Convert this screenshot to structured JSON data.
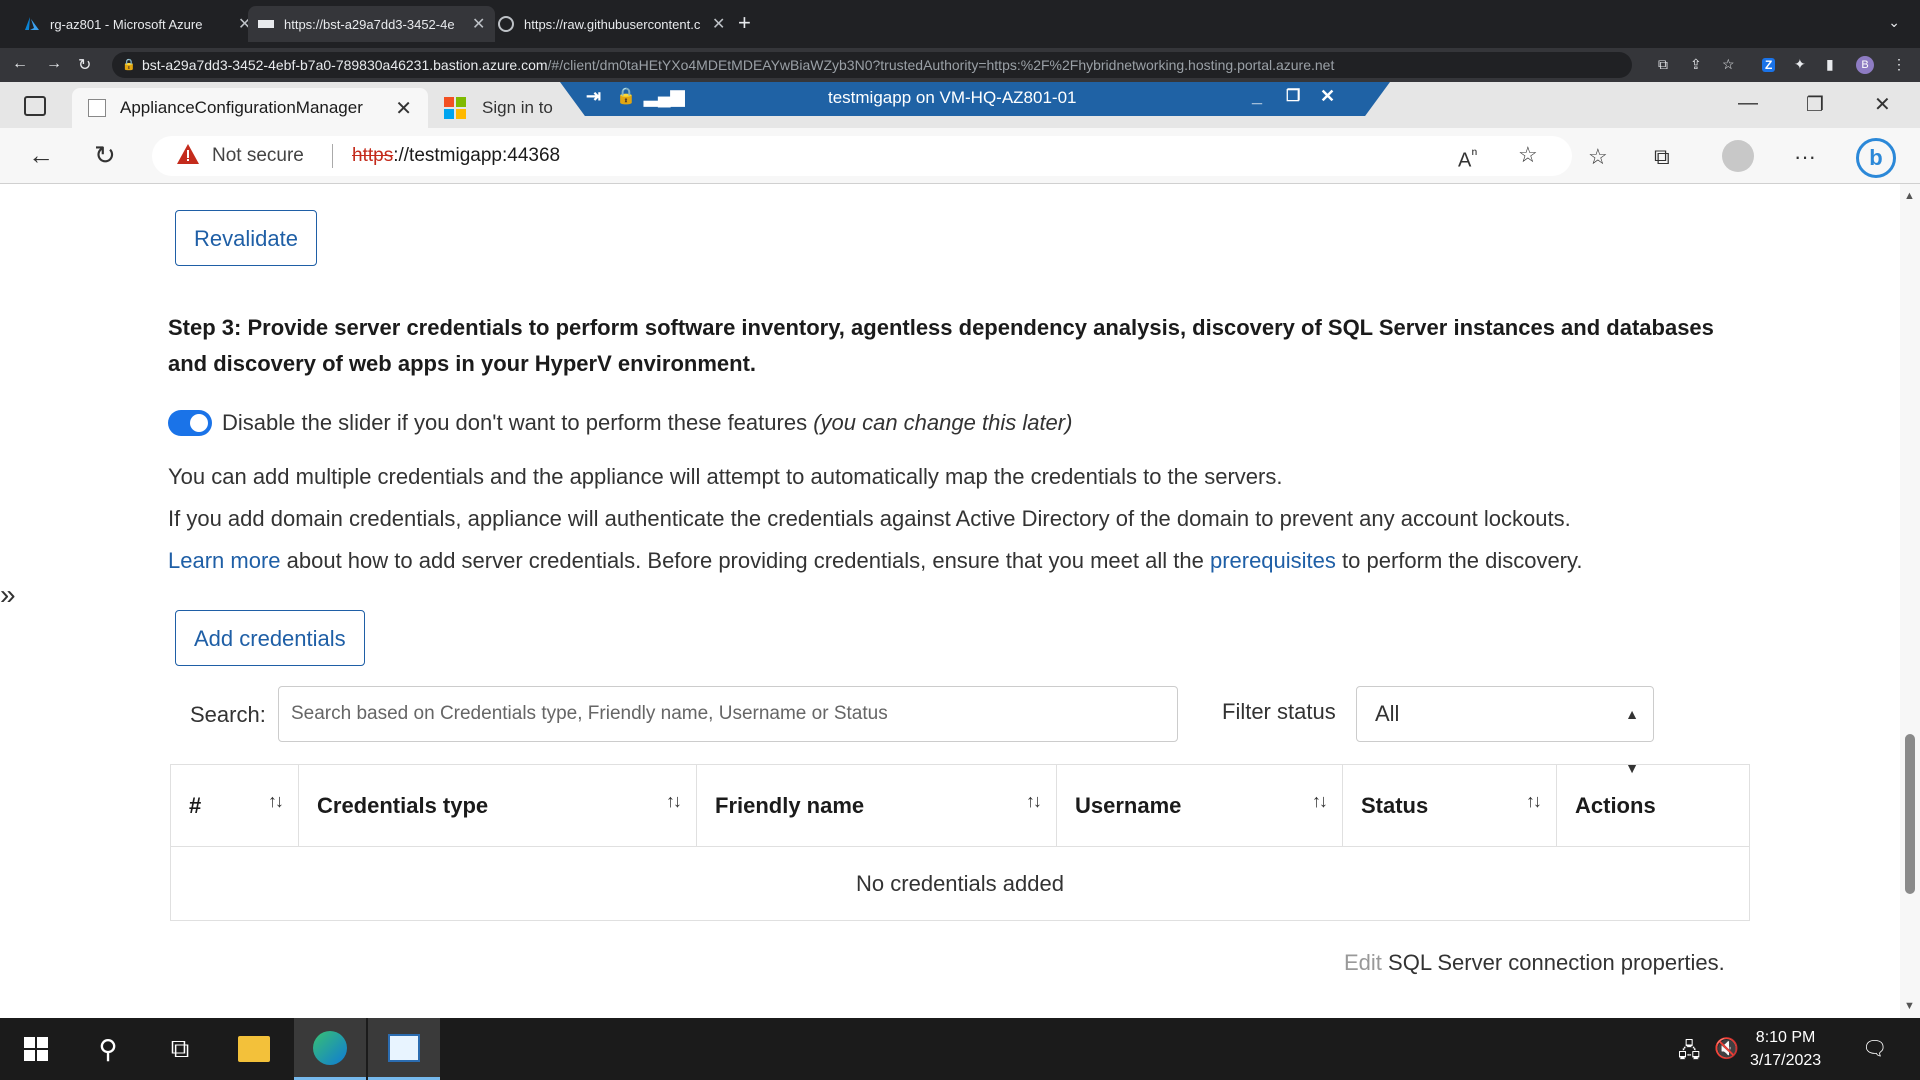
{
  "outer_browser": {
    "tabs": [
      {
        "title": "rg-az801 - Microsoft Azure"
      },
      {
        "title": "https://bst-a29a7dd3-3452-4e"
      },
      {
        "title": "https://raw.githubusercontent.c"
      }
    ],
    "url_host": "bst-a29a7dd3-3452-4ebf-b7a0-789830a46231.bastion.azure.com",
    "url_path": "/#/client/dm0taHEtYXo4MDEtMDEAYwBiaWZyb3N0?trustedAuthority=https:%2F%2Fhybridnetworking.hosting.portal.azure.net",
    "ext_z": "Z",
    "ext_b": "B"
  },
  "rdp": {
    "title": "testmigapp on VM-HQ-AZ801-01"
  },
  "edge": {
    "tabs": [
      {
        "title": "ApplianceConfigurationManager"
      },
      {
        "title": "Sign in to"
      }
    ],
    "security": "Not secure",
    "url_scheme": "https",
    "url_rest": "://testmigapp:44368",
    "bing_label": "b"
  },
  "content": {
    "revalidate_label": "Revalidate",
    "step3_title": "Step 3: Provide server credentials to perform software inventory, agentless dependency analysis, discovery of SQL Server instances and databases and discovery of web apps in your HyperV environment.",
    "toggle_text": "Disable the slider if you don't want to perform these features",
    "toggle_note": "(you can change this later)",
    "info_line1": "You can add multiple credentials and the appliance will attempt to automatically map the credentials to the servers.",
    "info_line2": "If you add domain credentials, appliance will authenticate the credentials against Active Directory of the domain to prevent any account lockouts.",
    "learn_more": "Learn more",
    "info_line3_mid": " about how to add server credentials. Before providing credentials, ensure that you meet all the ",
    "prerequisites": "prerequisites",
    "info_line3_end": " to perform the discovery.",
    "add_credentials_label": "Add credentials",
    "search_label": "Search:",
    "search_placeholder": "Search based on Credentials type, Friendly name, Username or Status",
    "filter_label": "Filter status",
    "filter_value": "All",
    "table": {
      "columns": [
        "#",
        "Credentials type",
        "Friendly name",
        "Username",
        "Status",
        "Actions"
      ],
      "empty_message": "No credentials added"
    },
    "edit_link": "Edit",
    "edit_rest": "SQL Server connection properties."
  },
  "taskbar": {
    "time": "8:10 PM",
    "date": "3/17/2023"
  }
}
